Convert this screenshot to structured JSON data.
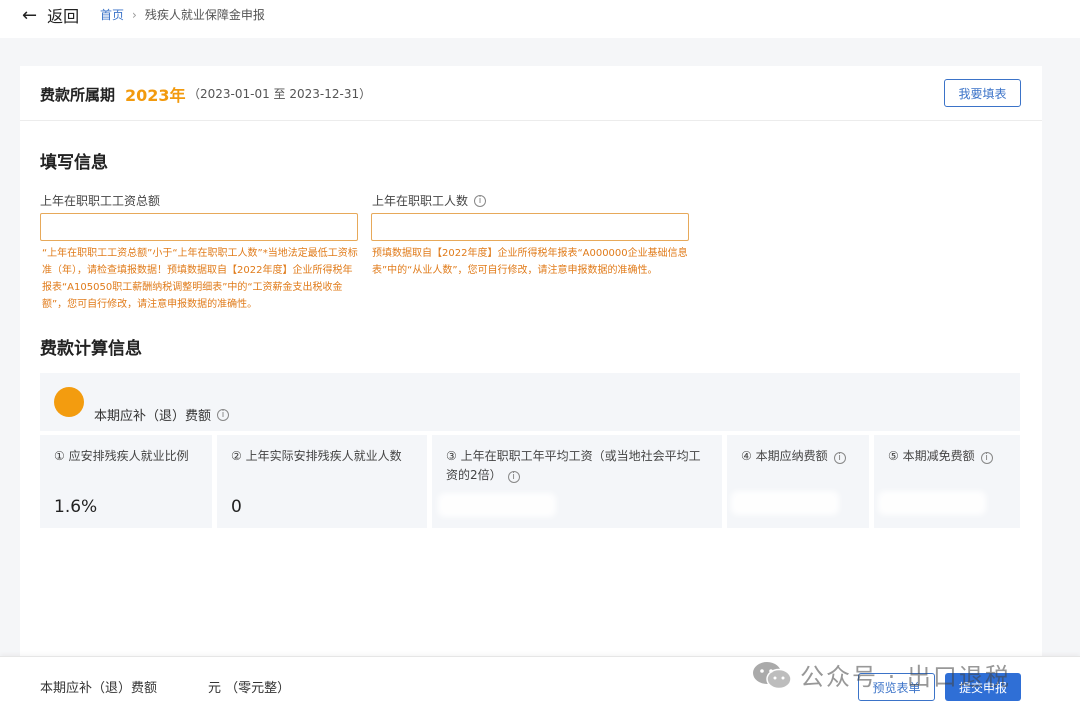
{
  "nav": {
    "back_label": "返回",
    "breadcrumb": {
      "home": "首页",
      "separator": "›",
      "current": "残疾人就业保障金申报"
    }
  },
  "period": {
    "label": "费款所属期",
    "year": "2023年",
    "range": "（2023-01-01 至 2023-12-31）",
    "fill_button": "我要填表"
  },
  "fill_info": {
    "title": "填写信息",
    "fields": [
      {
        "label": "上年在职职工工资总额",
        "value": "",
        "hint": "“上年在职职工工资总额”小于“上年在职职工人数”*当地法定最低工资标准（年），请检查填报数据！预填数据取自【2022年度】企业所得税年报表“A105050职工薪酬纳税调整明细表”中的“工资薪金支出税收金额”，您可自行修改，请注意申报数据的准确性。"
      },
      {
        "label": "上年在职职工人数",
        "value": "",
        "hint": "预填数据取自【2022年度】企业所得税年报表“A000000企业基础信息表”中的“从业人数”，您可自行修改，请注意申报数据的准确性。"
      }
    ]
  },
  "calc": {
    "title": "费款计算信息",
    "subtitle": "本期应补（退）费额",
    "cells": [
      {
        "label": "① 应安排残疾人就业比例",
        "value": "1.6%"
      },
      {
        "label": "② 上年实际安排残疾人就业人数",
        "value": "0"
      },
      {
        "label": "③ 上年在职职工年平均工资（或当地社会平均工资的2倍）",
        "value": ""
      },
      {
        "label": "④ 本期应纳费额",
        "value": ""
      },
      {
        "label": "⑤ 本期减免费额",
        "value": ""
      }
    ]
  },
  "footer": {
    "label": "本期应补（退）费额",
    "value": "元 （零元整）",
    "preview_button": "预览表单",
    "submit_button": "提交申报"
  },
  "watermark": "公众号 · 出口退税",
  "colors": {
    "accent": "#3b73c8",
    "orange": "#f29a0e",
    "hint": "#e07b1a",
    "submit": "#2f6fd6"
  }
}
